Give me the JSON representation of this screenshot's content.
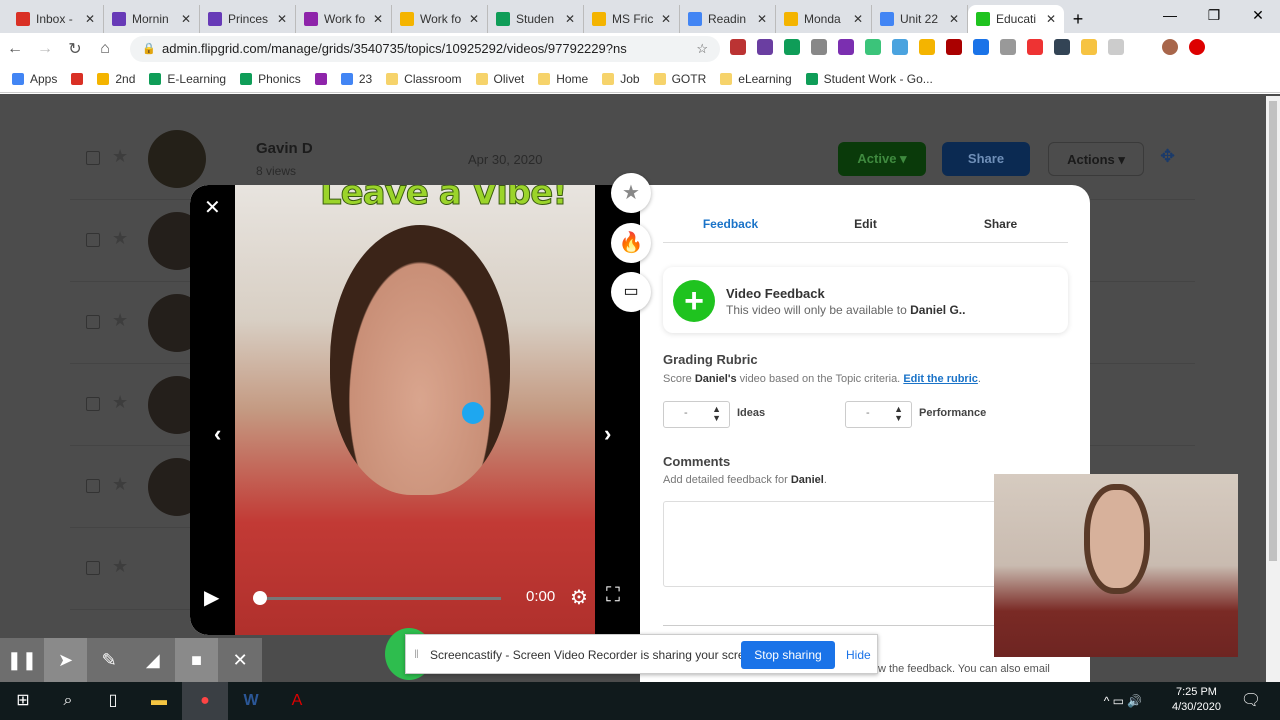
{
  "browser": {
    "tabs": [
      {
        "label": "Inbox -",
        "color": "#d93025"
      },
      {
        "label": "Mornin",
        "color": "#673ab7"
      },
      {
        "label": "Princes",
        "color": "#673ab7"
      },
      {
        "label": "Work fo",
        "color": "#8e24aa"
      },
      {
        "label": "Work fo",
        "color": "#f4b400"
      },
      {
        "label": "Studen",
        "color": "#0f9d58"
      },
      {
        "label": "MS Fric",
        "color": "#f4b400"
      },
      {
        "label": "Readin",
        "color": "#4285f4"
      },
      {
        "label": "Monda",
        "color": "#f4b400"
      },
      {
        "label": "Unit 22",
        "color": "#4285f4"
      },
      {
        "label": "Educati",
        "color": "#1fc31f",
        "active": true
      }
    ],
    "url": "admin.flipgrid.com/manage/grids/3540735/topics/10925292/videos/97792229?ns",
    "bookmarks": [
      "Apps",
      "",
      "2nd",
      "E-Learning",
      "Phonics",
      "",
      "23",
      "Classroom",
      "Olivet",
      "Home",
      "Job",
      "GOTR",
      "eLearning",
      "Student Work - Go..."
    ]
  },
  "background_list": {
    "name": "Gavin D",
    "views": "8 views",
    "date": "Apr 30, 2020",
    "status": "Active",
    "share": "Share",
    "actions": "Actions"
  },
  "video": {
    "overlay_text": "Leave a Vibe!",
    "time": "0:00",
    "progress": 0
  },
  "panel": {
    "tabs": [
      "Feedback",
      "Edit",
      "Share"
    ],
    "active_tab": "Feedback",
    "video_feedback": {
      "title": "Video Feedback",
      "subtitle": "This video will only be available to",
      "student": "Daniel G.."
    },
    "rubric": {
      "title": "Grading Rubric",
      "desc_pre": "Score",
      "student": "Daniel's",
      "desc_post": "video based on the Topic criteria.",
      "link": "Edit the rubric",
      "criteria": [
        {
          "label": "Ideas",
          "value": "-"
        },
        {
          "label": "Performance",
          "value": "-"
        }
      ]
    },
    "comments": {
      "title": "Comments",
      "desc": "Add detailed feedback for",
      "student": "Daniel",
      "value": ""
    },
    "footer_text": "w the feedback. You can also email"
  },
  "screencastify": {
    "message": "Screencastify - Screen Video Recorder is sharing your screen.",
    "stop": "Stop sharing",
    "hide": "Hide"
  },
  "taskbar": {
    "time": "7:25 PM",
    "date": "4/30/2020"
  },
  "colors": {
    "accent": "#1a73c8",
    "flipgrid_green": "#1fc31f",
    "stop_button": "#1a73e8"
  }
}
